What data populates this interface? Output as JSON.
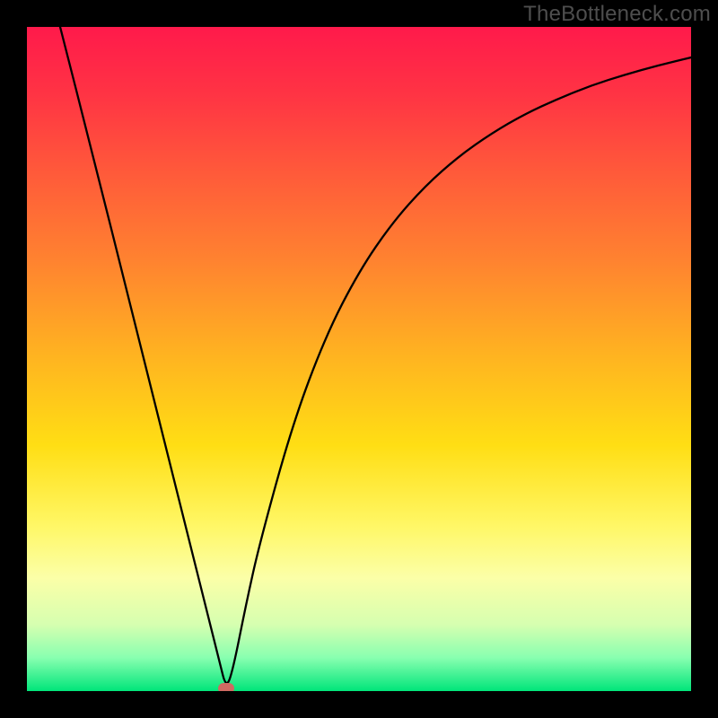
{
  "watermark": "TheBottleneck.com",
  "chart_data": {
    "type": "line",
    "title": "",
    "xlabel": "",
    "ylabel": "",
    "xlim": [
      0,
      100
    ],
    "ylim": [
      0,
      100
    ],
    "background_gradient": {
      "direction": "vertical",
      "stops": [
        {
          "pos": 0.0,
          "color": "#ff1a4b"
        },
        {
          "pos": 0.1,
          "color": "#ff3344"
        },
        {
          "pos": 0.22,
          "color": "#ff5a3a"
        },
        {
          "pos": 0.35,
          "color": "#ff8230"
        },
        {
          "pos": 0.5,
          "color": "#ffb520"
        },
        {
          "pos": 0.63,
          "color": "#ffde14"
        },
        {
          "pos": 0.75,
          "color": "#fff765"
        },
        {
          "pos": 0.83,
          "color": "#fbffa8"
        },
        {
          "pos": 0.9,
          "color": "#d6ffb0"
        },
        {
          "pos": 0.95,
          "color": "#88ffb0"
        },
        {
          "pos": 1.0,
          "color": "#00e57a"
        }
      ]
    },
    "series": [
      {
        "name": "bottleneck-curve",
        "color": "#000000",
        "x": [
          5,
          10,
          15,
          20,
          25,
          27,
          29,
          30,
          31,
          33,
          35,
          40,
          45,
          50,
          55,
          60,
          65,
          70,
          75,
          80,
          85,
          90,
          95,
          100
        ],
        "y": [
          100,
          80.4,
          60.4,
          40.4,
          20.4,
          12.4,
          4.4,
          0.4,
          3.1,
          13.1,
          22.1,
          40.2,
          53.5,
          63.2,
          70.5,
          76.1,
          80.5,
          84.0,
          86.9,
          89.2,
          91.2,
          92.8,
          94.2,
          95.4
        ]
      }
    ],
    "marker": {
      "name": "optimal-point",
      "x": 30,
      "y": 0.4,
      "color": "#cf6a62"
    },
    "grid": false,
    "legend": false
  }
}
